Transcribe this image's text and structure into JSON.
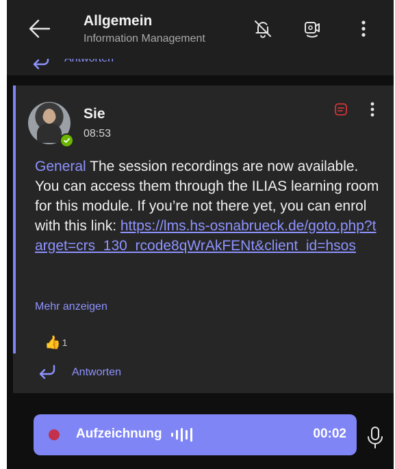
{
  "header": {
    "title": "Allgemein",
    "subtitle": "Information Management",
    "icons": [
      "back-arrow-icon",
      "bell-off-icon",
      "video-call-icon",
      "more-vertical-icon"
    ]
  },
  "previous": {
    "reply_label": "Antworten"
  },
  "message": {
    "sender": "Sie",
    "time": "08:53",
    "mention": "General",
    "text": " The session recordings are now available. You can access them through the ILIAS learning room for this module. If you’re not there yet, you can enrol with this link: ",
    "link": "https://lms.hs-osnabrueck.de/goto.php?target=crs_130_rcode8qWrAkFENt&client_id=hsos",
    "show_more": "Mehr anzeigen",
    "reaction_emoji": "👍",
    "reaction_count": "1",
    "reply_label": "Antworten"
  },
  "recording": {
    "label": "Aufzeichnung",
    "duration": "00:02"
  },
  "colors": {
    "accent": "#7f85f5",
    "link": "#8e93ff",
    "background": "#0f0f0f",
    "card": "#262626",
    "record_dot": "#c4314b",
    "presence": "#6bb700"
  }
}
